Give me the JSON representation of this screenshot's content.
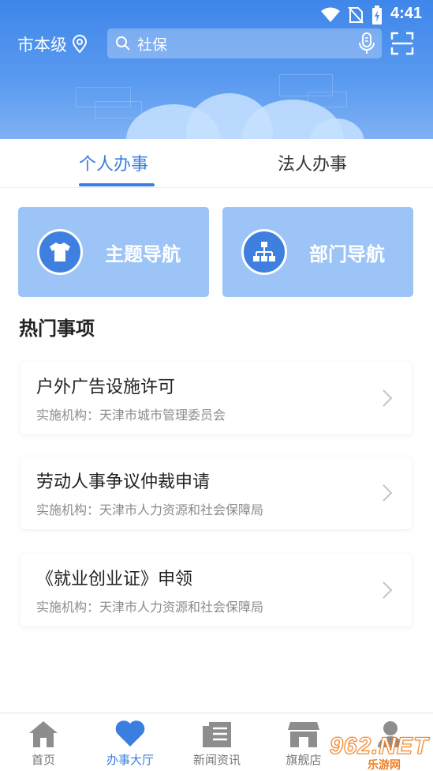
{
  "status": {
    "time": "4:41"
  },
  "topbar": {
    "city": "市本级",
    "search_text": "社保"
  },
  "tabs": [
    {
      "label": "个人办事",
      "active": true
    },
    {
      "label": "法人办事",
      "active": false
    }
  ],
  "nav_cards": [
    {
      "label": "主题导航",
      "icon": "shirt-icon"
    },
    {
      "label": "部门导航",
      "icon": "org-chart-icon"
    }
  ],
  "section_title": "热门事项",
  "hot_items": [
    {
      "title": "户外广告设施许可",
      "org": "实施机构：天津市城市管理委员会"
    },
    {
      "title": "劳动人事争议仲裁申请",
      "org": "实施机构：天津市人力资源和社会保障局"
    },
    {
      "title": "《就业创业证》申领",
      "org": "实施机构：天津市人力资源和社会保障局"
    }
  ],
  "bottom_nav": [
    {
      "label": "首页",
      "icon": "home-icon",
      "active": false
    },
    {
      "label": "办事大厅",
      "icon": "heart-icon",
      "active": true
    },
    {
      "label": "新闻资讯",
      "icon": "news-icon",
      "active": false
    },
    {
      "label": "旗舰店",
      "icon": "store-icon",
      "active": false
    },
    {
      "label": "",
      "icon": "user-icon",
      "active": false
    }
  ],
  "watermark": {
    "big": "962.NET",
    "small": "乐游网"
  },
  "colors": {
    "header_blue": "#3f86ea",
    "accent": "#3a7fe0",
    "card_bg": "#9cc4f7"
  }
}
